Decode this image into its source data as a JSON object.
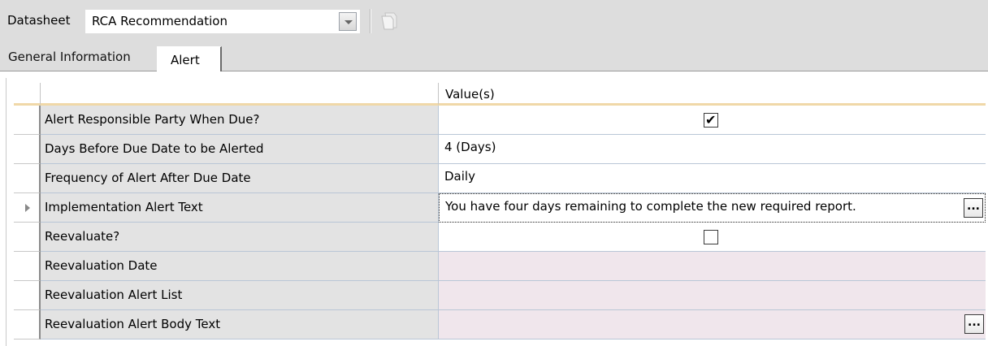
{
  "toolbar": {
    "datasheet_label": "Datasheet",
    "datasheet_value": "RCA Recommendation",
    "dropdown_icon": "chevron-down-icon",
    "copy_icon": "copy-icon"
  },
  "tabs": [
    {
      "label": "General Information",
      "active": false
    },
    {
      "label": "Alert",
      "active": true
    }
  ],
  "grid": {
    "value_header": "Value(s)",
    "rows": [
      {
        "label": "Alert Responsible Party When Due?",
        "type": "checkbox",
        "checked": true
      },
      {
        "label": "Days Before Due Date to be Alerted",
        "type": "text",
        "value": "4 (Days)"
      },
      {
        "label": "Frequency of Alert After Due Date",
        "type": "text",
        "value": "Daily"
      },
      {
        "label": "Implementation Alert Text",
        "type": "text-ellipsis",
        "value": "You have four days remaining to complete the new required report.",
        "current": true
      },
      {
        "label": "Reevaluate?",
        "type": "checkbox",
        "checked": false
      },
      {
        "label": "Reevaluation Date",
        "type": "disabled",
        "value": ""
      },
      {
        "label": "Reevaluation Alert List",
        "type": "disabled",
        "value": ""
      },
      {
        "label": "Reevaluation Alert Body Text",
        "type": "disabled-ellipsis",
        "value": ""
      }
    ],
    "ellipsis_label": "...",
    "check_mark": "✔"
  },
  "colors": {
    "toolbar_bg": "#dddddd",
    "label_cell_bg": "#e3e3e3",
    "disabled_cell_bg": "#f0e6ec",
    "header_underline": "#f0d8a8"
  }
}
